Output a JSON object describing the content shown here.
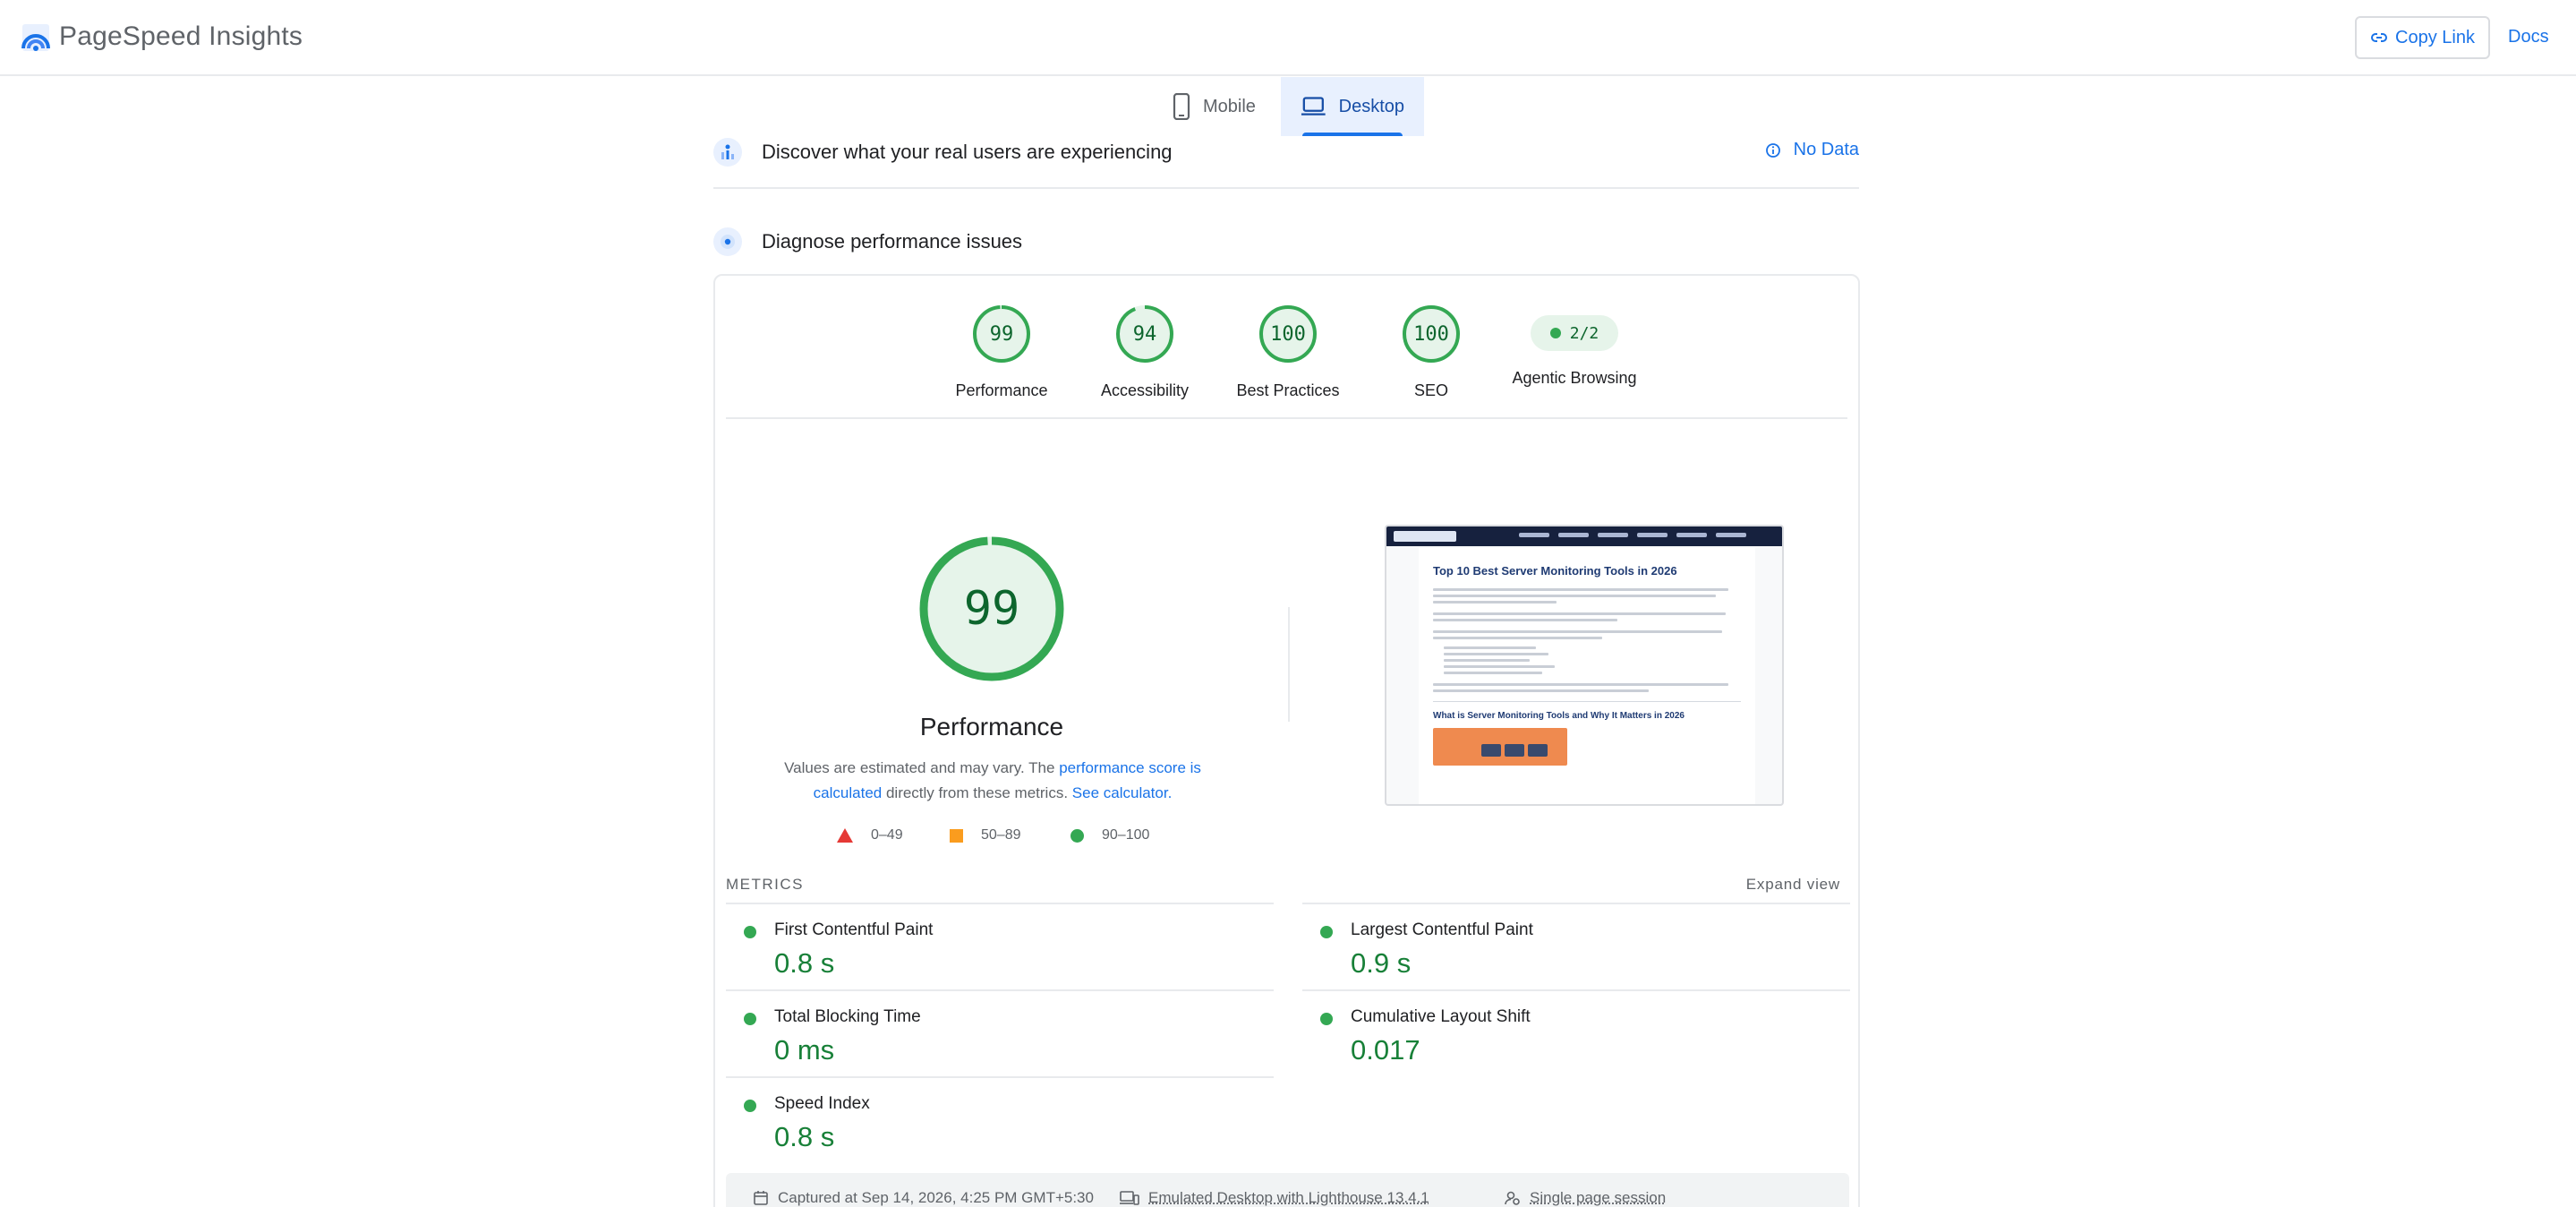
{
  "header": {
    "app_title": "PageSpeed Insights",
    "copy_link_label": "Copy Link",
    "docs_label": "Docs"
  },
  "device_tabs": {
    "mobile_label": "Mobile",
    "desktop_label": "Desktop",
    "selected": "Desktop"
  },
  "field_data": {
    "title": "Discover what your real users are experiencing",
    "status_label": "No Data"
  },
  "lab_data": {
    "title": "Diagnose performance issues"
  },
  "scores": [
    {
      "label": "Performance",
      "value": "99"
    },
    {
      "label": "Accessibility",
      "value": "94"
    },
    {
      "label": "Best Practices",
      "value": "100"
    },
    {
      "label": "SEO",
      "value": "100"
    },
    {
      "label": "Agentic Browsing",
      "value": "2/2"
    }
  ],
  "performance": {
    "score": "99",
    "title": "Performance",
    "note_prefix": "Values are estimated and may vary. The ",
    "note_link1": "performance score is calculated",
    "note_middle": " directly from these metrics. ",
    "note_link2": "See calculator."
  },
  "legend": {
    "fail": "0–49",
    "average": "50–89",
    "pass": "90–100"
  },
  "screenshot": {
    "heading": "Top 10 Best Server Monitoring Tools in 2026",
    "subheading": "What is Server Monitoring Tools and Why It Matters in 2026"
  },
  "metrics": {
    "header": "METRICS",
    "expand_label": "Expand view",
    "items": [
      {
        "name": "First Contentful Paint",
        "value": "0.8 s"
      },
      {
        "name": "Largest Contentful Paint",
        "value": "0.9 s"
      },
      {
        "name": "Total Blocking Time",
        "value": "0 ms"
      },
      {
        "name": "Cumulative Layout Shift",
        "value": "0.017"
      },
      {
        "name": "Speed Index",
        "value": "0.8 s"
      }
    ]
  },
  "footer": {
    "captured": "Captured at Sep 14, 2026, 4:25 PM GMT+5:30",
    "emulation": "Emulated Desktop with Lighthouse 13.4.1",
    "session": "Single page session"
  },
  "colors": {
    "accent": "#1a73e8",
    "pass": "#34a853",
    "pass_text": "#0d652d",
    "average": "#fa9c1e",
    "fail": "#e53935"
  }
}
